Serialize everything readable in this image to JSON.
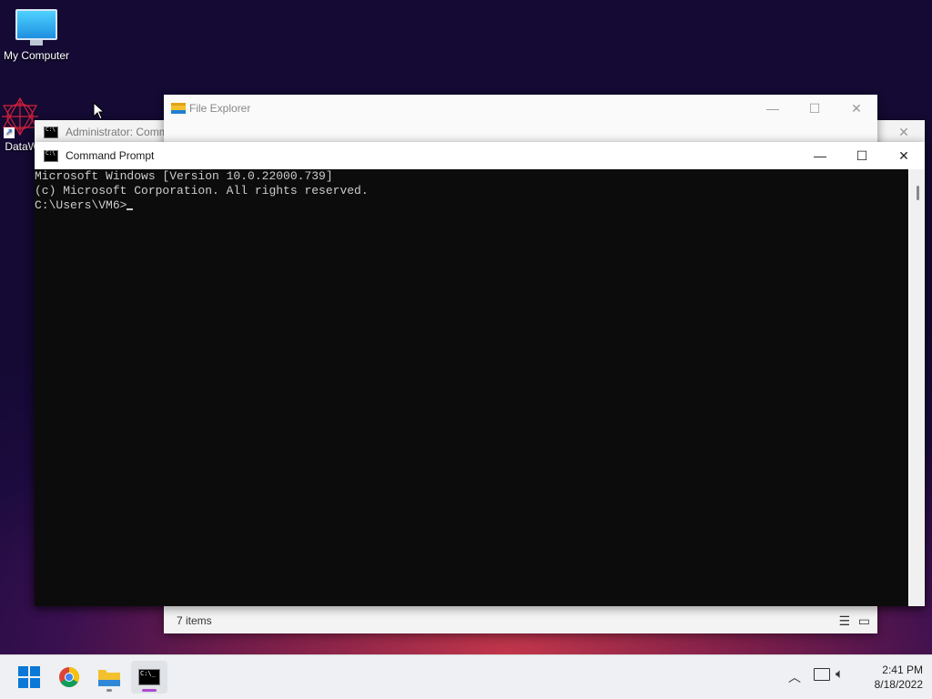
{
  "desktop": {
    "icons": [
      {
        "label": "My Computer",
        "icon": "monitor-icon"
      },
      {
        "label": "DataW",
        "icon": "datawrapper-shortcut-icon"
      }
    ]
  },
  "admin_cmd": {
    "title": "Administrator: Comm"
  },
  "explorer": {
    "title": "File Explorer",
    "status": "7 items"
  },
  "cmd": {
    "title": "Command Prompt",
    "lines": [
      "Microsoft Windows [Version 10.0.22000.739]",
      "(c) Microsoft Corporation. All rights reserved.",
      "",
      "C:\\Users\\VM6>"
    ]
  },
  "taskbar": {
    "apps": [
      {
        "name": "start-button",
        "icon": "windows-logo-icon"
      },
      {
        "name": "chrome",
        "icon": "chrome-icon"
      },
      {
        "name": "file-explorer",
        "icon": "folder-icon"
      },
      {
        "name": "command-prompt",
        "icon": "terminal-icon"
      }
    ],
    "time": "2:41 PM",
    "date": "8/18/2022"
  },
  "colors": {
    "console_bg": "#0c0c0c",
    "console_fg": "#cccccc",
    "accent": "#0078d4"
  }
}
